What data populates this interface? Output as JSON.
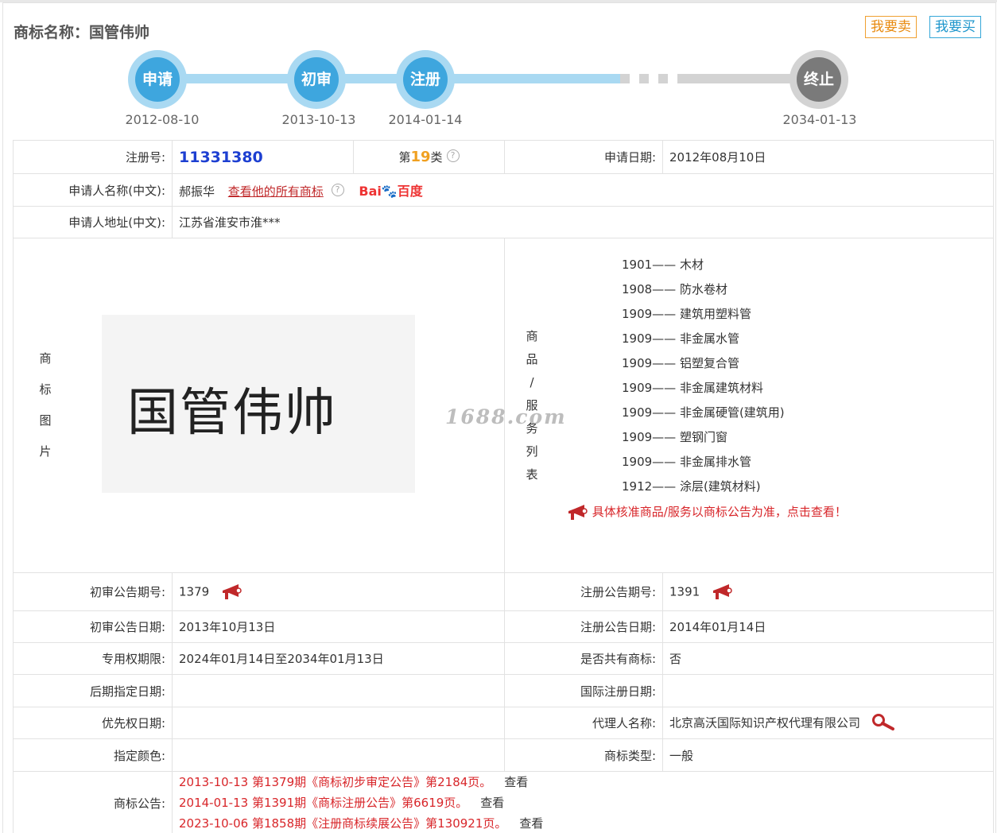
{
  "header": {
    "title": "商标名称：国管伟帅",
    "sell_label": "我要卖",
    "buy_label": "我要买"
  },
  "timeline": {
    "steps": [
      {
        "label": "申请",
        "date": "2012-08-10",
        "status": "done"
      },
      {
        "label": "初审",
        "date": "2013-10-13",
        "status": "done"
      },
      {
        "label": "注册",
        "date": "2014-01-14",
        "status": "done"
      },
      {
        "label": "终止",
        "date": "2034-01-13",
        "status": "future"
      }
    ]
  },
  "info": {
    "reg_no_label": "注册号:",
    "reg_no": "11331380",
    "class_prefix": "第",
    "class_num": "19",
    "class_suffix": "类",
    "apply_date_label": "申请日期:",
    "apply_date": "2012年08月10日",
    "applicant_label": "申请人名称(中文):",
    "applicant": "郝振华",
    "view_all_link": "查看他的所有商标",
    "baidu_text": "Bai",
    "baidu_cn": "百度",
    "address_label": "申请人地址(中文):",
    "address": "江苏省淮安市淮***",
    "image_label": [
      "商",
      "标",
      "图",
      "片"
    ],
    "mark_text": "国管伟帅",
    "watermark": "1688.com",
    "goods_label": [
      "商",
      "品",
      "/",
      "服",
      "务",
      "列",
      "表"
    ],
    "goods": [
      "1901—— 木材",
      "1908—— 防水卷材",
      "1909—— 建筑用塑料管",
      "1909—— 非金属水管",
      "1909—— 铝塑复合管",
      "1909—— 非金属建筑材料",
      "1909—— 非金属硬管(建筑用)",
      "1909—— 塑钢门窗",
      "1909—— 非金属排水管",
      "1912—— 涂层(建筑材料)"
    ],
    "goods_notice": "具体核准商品/服务以商标公告为准，点击查看！",
    "prelim_no_label": "初审公告期号:",
    "prelim_no": "1379",
    "reg_pub_no_label": "注册公告期号:",
    "reg_pub_no": "1391",
    "prelim_date_label": "初审公告日期:",
    "prelim_date": "2013年10月13日",
    "reg_pub_date_label": "注册公告日期:",
    "reg_pub_date": "2014年01月14日",
    "exclusive_label": "专用权期限:",
    "exclusive": "2024年01月14日至2034年01月13日",
    "shared_label": "是否共有商标:",
    "shared": "否",
    "later_date_label": "后期指定日期:",
    "later_date": "",
    "intl_date_label": "国际注册日期:",
    "intl_date": "",
    "priority_label": "优先权日期:",
    "priority": "",
    "agent_label": "代理人名称:",
    "agent": "北京高沃国际知识产权代理有限公司",
    "color_label": "指定颜色:",
    "color": "",
    "type_label": "商标类型:",
    "type": "一般",
    "pub_label": "商标公告:",
    "publications": [
      {
        "text": "2013-10-13 第1379期《商标初步审定公告》第2184页。",
        "view": "查看"
      },
      {
        "text": "2014-01-13 第1391期《商标注册公告》第6619页。",
        "view": "查看"
      },
      {
        "text": "2023-10-06 第1858期《注册商标续展公告》第130921页。",
        "view": "查看"
      }
    ]
  },
  "colors": {
    "accent_blue": "#3ea6de",
    "track_blue": "#a9d9f2",
    "gray_node": "#7a7a7a",
    "link_red": "#c0282a",
    "reg_blue": "#1d3fd1",
    "class_orange": "#f0a020"
  }
}
